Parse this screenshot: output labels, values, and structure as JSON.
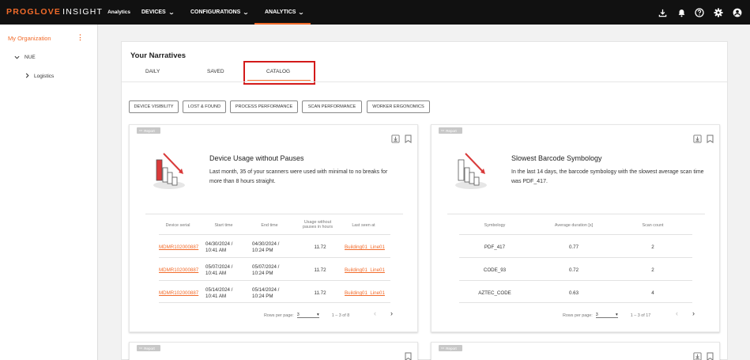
{
  "topbar": {
    "brand_main": "PROGLOVE",
    "brand_second": "INSIGHT",
    "brand_sub": "Analytics",
    "nav": [
      {
        "label": "DEVICES"
      },
      {
        "label": "CONFIGURATIONS"
      },
      {
        "label": "ANALYTICS"
      }
    ],
    "icons": [
      "download-icon",
      "bell-icon",
      "help-icon",
      "gear-icon",
      "account-icon"
    ]
  },
  "sidebar": {
    "org_label": "My Organization",
    "tree": [
      {
        "label": "NUE",
        "expanded": true
      },
      {
        "label": "Logistics",
        "expanded": false
      }
    ]
  },
  "main": {
    "title": "Your Narratives",
    "tabs": [
      {
        "label": "DAILY"
      },
      {
        "label": "SAVED"
      },
      {
        "label": "CATALOG",
        "active": true
      }
    ],
    "filters": [
      "DEVICE VISIBILITY",
      "LOST & FOUND",
      "PROCESS PERFORMANCE",
      "SCAN PERFORMANCE",
      "WORKER ERGONOMICS"
    ]
  },
  "cards": [
    {
      "badge": "Report",
      "title": "Device Usage without Pauses",
      "description": "Last month, 35 of your scanners were used with minimal to no breaks for more than 8 hours straight.",
      "columns": [
        "Device serial",
        "Start time",
        "End time",
        "Usage without pauses in hours",
        "Last seen at"
      ],
      "rows": [
        [
          "MDMR102000887",
          "04/30/2024 / 10:41 AM",
          "04/30/2024 / 10:24 PM",
          "11.72",
          "Building01_Line01"
        ],
        [
          "MDMR102000887",
          "05/07/2024 / 10:41 AM",
          "05/07/2024 / 10:24 PM",
          "11.72",
          "Building01_Line01"
        ],
        [
          "MDMR102000887",
          "05/14/2024 / 10:41 AM",
          "05/14/2024 / 10:24 PM",
          "11.72",
          "Building01_Line01"
        ]
      ],
      "pager": {
        "rows_label": "Rows per page:",
        "rows_value": "3",
        "range": "1 – 3 of 8"
      }
    },
    {
      "badge": "Report",
      "title": "Slowest Barcode Symbology",
      "description": "In the last 14 days, the barcode symbology with the slowest average scan time was PDF_417.",
      "columns": [
        "Symbology",
        "Average duration [s]",
        "Scan count"
      ],
      "rows": [
        [
          "PDF_417",
          "0.77",
          "2"
        ],
        [
          "CODE_93",
          "0.72",
          "2"
        ],
        [
          "AZTEC_CODE",
          "0.63",
          "4"
        ]
      ],
      "pager": {
        "rows_label": "Rows per page:",
        "rows_value": "3",
        "range": "1 – 3 of 17"
      }
    },
    {
      "badge": "Report"
    },
    {
      "badge": "Report"
    }
  ],
  "colors": {
    "accent": "#f26b2a",
    "topbar": "#111111",
    "highlight": "#d31a1a"
  }
}
